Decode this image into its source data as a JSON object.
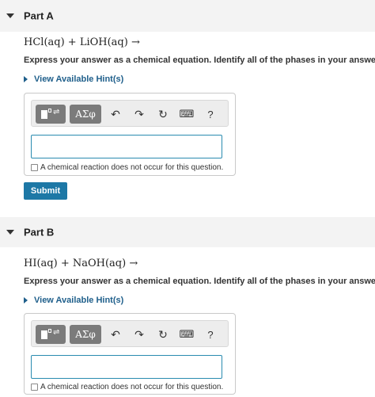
{
  "parts": [
    {
      "title": "Part A",
      "equation": "HCl(aq) + LiOH(aq) →",
      "instruction": "Express your answer as a chemical equation. Identify all of the phases in your answer.",
      "hint_label": "View Available Hint(s)",
      "toolbar": {
        "symbols_label": "ΑΣφ",
        "undo_icon": "↶",
        "redo_icon": "↷",
        "reset_icon": "↻",
        "keyboard_icon": "⌨",
        "help_label": "?"
      },
      "answer_value": "",
      "no_reaction_label": "A chemical reaction does not occur for this question.",
      "submit_label": "Submit"
    },
    {
      "title": "Part B",
      "equation": "HI(aq) + NaOH(aq) →",
      "instruction": "Express your answer as a chemical equation. Identify all of the phases in your answer.",
      "hint_label": "View Available Hint(s)",
      "toolbar": {
        "symbols_label": "ΑΣφ",
        "undo_icon": "↶",
        "redo_icon": "↷",
        "reset_icon": "↻",
        "keyboard_icon": "⌨",
        "help_label": "?"
      },
      "answer_value": "",
      "no_reaction_label": "A chemical reaction does not occur for this question."
    }
  ],
  "colors": {
    "link": "#1f5f8b",
    "submit": "#1d78a6",
    "input_border": "#2a8bb0",
    "header_bg": "#f3f3f3"
  }
}
